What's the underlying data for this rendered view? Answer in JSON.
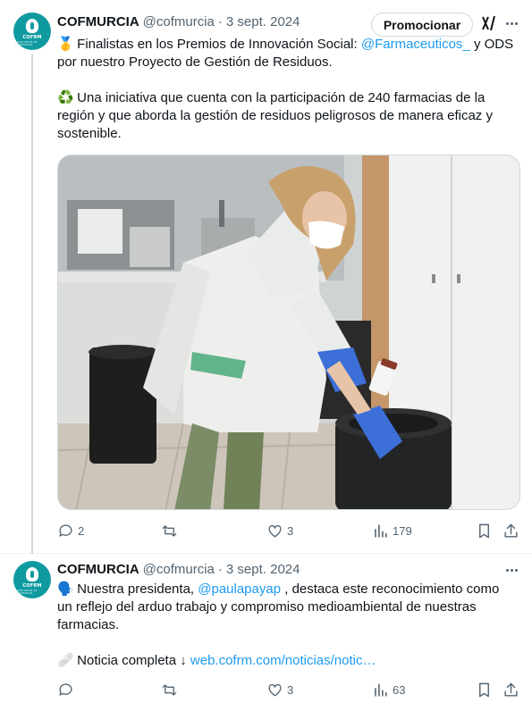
{
  "tweets": [
    {
      "author_name": "COFMURCIA",
      "handle": "@cofmurcia",
      "separator": "·",
      "date": "3 sept. 2024",
      "avatar": {
        "text": "COFRM",
        "subtext": "COLEGIO OFICIAL DE FARMACÉUTICOS"
      },
      "promote_label": "Promocionar",
      "lines": {
        "medal_emoji": "🥇",
        "p1_a": "Finalistas en los Premios de Innovación Social:",
        "mention": "@Farmaceuticos_",
        "p1_b": "y ODS por nuestro Proyecto de Gestión de Residuos.",
        "recycle_emoji": "♻️",
        "p2": "Una iniciativa que cuenta con la participación de 240 farmacias de la región y que aborda la gestión de residuos peligrosos de manera eficaz y sostenible."
      },
      "actions": {
        "reply_count": "2",
        "repost_count": "",
        "like_count": "3",
        "views_count": "179"
      }
    },
    {
      "author_name": "COFMURCIA",
      "handle": "@cofmurcia",
      "separator": "·",
      "date": "3 sept. 2024",
      "avatar": {
        "text": "COFRM",
        "subtext": "COLEGIO OFICIAL DE FARMACÉUTICOS"
      },
      "lines": {
        "speaker_emoji": "🗣️",
        "p1_a": "Nuestra presidenta,",
        "mention": "@paulapayap",
        "p1_b": ", destaca este reconocimiento como un reflejo del arduo trabajo y compromiso medioambiental de nuestras farmacias.",
        "pill_emoji": "🩹",
        "p2_a": "Noticia completa ↓",
        "link": "web.cofrm.com/noticias/notic…"
      },
      "actions": {
        "reply_count": "",
        "repost_count": "",
        "like_count": "3",
        "views_count": "63"
      }
    }
  ],
  "icons": {
    "reply": "reply-icon",
    "repost": "repost-icon",
    "like": "heart-icon",
    "views": "views-icon",
    "bookmark": "bookmark-icon",
    "share": "share-icon",
    "more": "more-icon",
    "grok": "grok-icon"
  },
  "colors": {
    "accent": "#1d9bf0",
    "muted": "#536471",
    "text": "#0f1419",
    "avatar_bg": "#0f9aa0"
  }
}
